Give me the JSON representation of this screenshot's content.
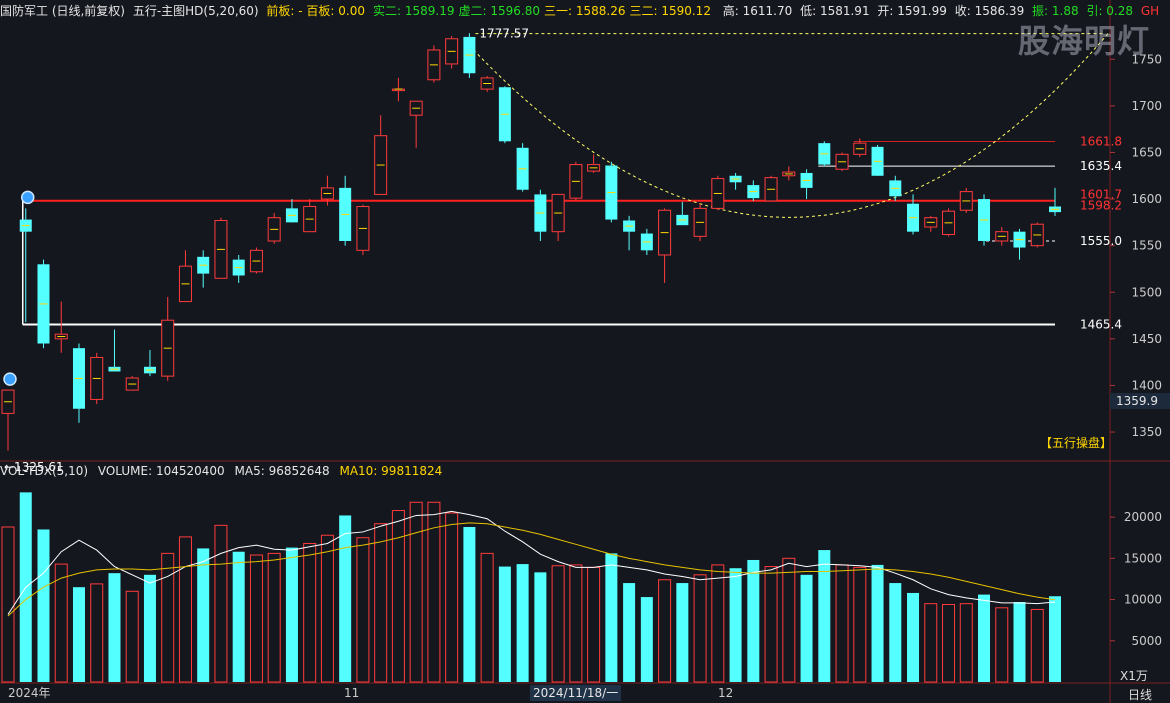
{
  "header": {
    "stock": "国防军工 (日线,前复权)",
    "indicator": "五行-主图HD(5,20,60)",
    "v1": "前板: - 百板: 0.00",
    "v2": "",
    "v3": "实二: 1589.19",
    "v4": "虚二: 1596.80",
    "v5": "三一: 1588.26",
    "v6": "三二: 1590.12",
    "high": "高: 1611.70",
    "low": "低: 1581.91",
    "open": "开: 1591.99",
    "close": "收: 1586.39",
    "amplitude": "振: 1.88",
    "ref": "引: 0.28",
    "gh": "GH"
  },
  "watermark": "股海明灯",
  "badge": "【五行操盘】",
  "current_price_tag": "1359.9",
  "volume_unit": "X1万",
  "period": "日线",
  "x_labels": [
    "2024年",
    "11",
    "2024/11/18/一",
    "12"
  ],
  "volume_header": {
    "name": "VOL-TDX(5,10)",
    "volume": "VOLUME: 104520400",
    "ma5": "MA5: 96852648",
    "ma10": "MA10: 99811824"
  },
  "chart_data": {
    "type": "candlestick",
    "price_axis": {
      "ticks": [
        1350,
        1400,
        1450,
        1500,
        1550,
        1600,
        1650,
        1700,
        1750
      ],
      "range": [
        1320,
        1790
      ]
    },
    "volume_axis": {
      "ticks": [
        5000,
        10000,
        15000,
        20000
      ],
      "range": [
        0,
        24500
      ],
      "unit": "万"
    },
    "price_labels": [
      {
        "text": "1777.57",
        "value": 1777.57
      },
      {
        "text": "←1325.61",
        "value": 1325.61
      },
      {
        "text": "1661.8",
        "value": 1661.8
      },
      {
        "text": "1635.4",
        "value": 1635.4
      },
      {
        "text": "1601.7",
        "value": 1601.7
      },
      {
        "text": "1598.2",
        "value": 1598.2
      },
      {
        "text": "1555.0",
        "value": 1555.0
      },
      {
        "text": "1465.4",
        "value": 1465.4
      }
    ],
    "levels": [
      {
        "value": 1598.2,
        "color": "#ff2020"
      },
      {
        "value": 1465.4,
        "color": "#ffffff"
      },
      {
        "value": 1635.4,
        "color": "#ffffff"
      },
      {
        "value": 1661.8,
        "color": "#d02020"
      },
      {
        "value": 1777.57,
        "color": "#ffff66"
      }
    ],
    "candles": [
      {
        "o": 1370,
        "h": 1395,
        "l": 1330,
        "c": 1395
      },
      {
        "o": 1578,
        "h": 1590,
        "l": 1468,
        "c": 1565
      },
      {
        "o": 1530,
        "h": 1535,
        "l": 1440,
        "c": 1445
      },
      {
        "o": 1450,
        "h": 1490,
        "l": 1435,
        "c": 1455
      },
      {
        "o": 1440,
        "h": 1445,
        "l": 1360,
        "c": 1375
      },
      {
        "o": 1385,
        "h": 1435,
        "l": 1380,
        "c": 1430
      },
      {
        "o": 1420,
        "h": 1460,
        "l": 1415,
        "c": 1415
      },
      {
        "o": 1395,
        "h": 1410,
        "l": 1395,
        "c": 1408
      },
      {
        "o": 1420,
        "h": 1438,
        "l": 1410,
        "c": 1413
      },
      {
        "o": 1410,
        "h": 1495,
        "l": 1405,
        "c": 1470
      },
      {
        "o": 1490,
        "h": 1545,
        "l": 1490,
        "c": 1528
      },
      {
        "o": 1538,
        "h": 1545,
        "l": 1505,
        "c": 1520
      },
      {
        "o": 1515,
        "h": 1580,
        "l": 1515,
        "c": 1577
      },
      {
        "o": 1535,
        "h": 1540,
        "l": 1510,
        "c": 1518
      },
      {
        "o": 1522,
        "h": 1548,
        "l": 1520,
        "c": 1545
      },
      {
        "o": 1555,
        "h": 1585,
        "l": 1552,
        "c": 1580
      },
      {
        "o": 1590,
        "h": 1600,
        "l": 1575,
        "c": 1575
      },
      {
        "o": 1565,
        "h": 1600,
        "l": 1565,
        "c": 1592
      },
      {
        "o": 1600,
        "h": 1625,
        "l": 1593,
        "c": 1612
      },
      {
        "o": 1612,
        "h": 1625,
        "l": 1550,
        "c": 1555
      },
      {
        "o": 1545,
        "h": 1594,
        "l": 1540,
        "c": 1592
      },
      {
        "o": 1605,
        "h": 1690,
        "l": 1605,
        "c": 1668
      },
      {
        "o": 1718,
        "h": 1730,
        "l": 1705,
        "c": 1718
      },
      {
        "o": 1690,
        "h": 1705,
        "l": 1655,
        "c": 1705
      },
      {
        "o": 1728,
        "h": 1765,
        "l": 1725,
        "c": 1760
      },
      {
        "o": 1745,
        "h": 1775,
        "l": 1740,
        "c": 1772
      },
      {
        "o": 1774,
        "h": 1778,
        "l": 1730,
        "c": 1735
      },
      {
        "o": 1718,
        "h": 1732,
        "l": 1715,
        "c": 1730
      },
      {
        "o": 1720,
        "h": 1721,
        "l": 1660,
        "c": 1662
      },
      {
        "o": 1655,
        "h": 1660,
        "l": 1608,
        "c": 1610
      },
      {
        "o": 1605,
        "h": 1610,
        "l": 1555,
        "c": 1565
      },
      {
        "o": 1565,
        "h": 1605,
        "l": 1555,
        "c": 1605
      },
      {
        "o": 1601,
        "h": 1640,
        "l": 1598,
        "c": 1637
      },
      {
        "o": 1630,
        "h": 1648,
        "l": 1628,
        "c": 1637
      },
      {
        "o": 1636,
        "h": 1640,
        "l": 1575,
        "c": 1578
      },
      {
        "o": 1577,
        "h": 1582,
        "l": 1545,
        "c": 1565
      },
      {
        "o": 1563,
        "h": 1568,
        "l": 1540,
        "c": 1545
      },
      {
        "o": 1540,
        "h": 1590,
        "l": 1510,
        "c": 1588
      },
      {
        "o": 1583,
        "h": 1597,
        "l": 1575,
        "c": 1572
      },
      {
        "o": 1560,
        "h": 1595,
        "l": 1555,
        "c": 1590
      },
      {
        "o": 1590,
        "h": 1625,
        "l": 1588,
        "c": 1622
      },
      {
        "o": 1625,
        "h": 1628,
        "l": 1610,
        "c": 1618
      },
      {
        "o": 1615,
        "h": 1620,
        "l": 1598,
        "c": 1601
      },
      {
        "o": 1598,
        "h": 1625,
        "l": 1598,
        "c": 1623
      },
      {
        "o": 1625,
        "h": 1635,
        "l": 1620,
        "c": 1629
      },
      {
        "o": 1628,
        "h": 1632,
        "l": 1600,
        "c": 1612
      },
      {
        "o": 1660,
        "h": 1662,
        "l": 1635,
        "c": 1637
      },
      {
        "o": 1632,
        "h": 1650,
        "l": 1630,
        "c": 1648
      },
      {
        "o": 1648,
        "h": 1665,
        "l": 1645,
        "c": 1660
      },
      {
        "o": 1656,
        "h": 1658,
        "l": 1625,
        "c": 1625
      },
      {
        "o": 1620,
        "h": 1625,
        "l": 1598,
        "c": 1603
      },
      {
        "o": 1595,
        "h": 1605,
        "l": 1562,
        "c": 1565
      },
      {
        "o": 1570,
        "h": 1582,
        "l": 1565,
        "c": 1580
      },
      {
        "o": 1562,
        "h": 1590,
        "l": 1560,
        "c": 1587
      },
      {
        "o": 1588,
        "h": 1612,
        "l": 1585,
        "c": 1608
      },
      {
        "o": 1600,
        "h": 1605,
        "l": 1550,
        "c": 1555
      },
      {
        "o": 1555,
        "h": 1570,
        "l": 1550,
        "c": 1565
      },
      {
        "o": 1565,
        "h": 1568,
        "l": 1535,
        "c": 1548
      },
      {
        "o": 1550,
        "h": 1575,
        "l": 1548,
        "c": 1573
      },
      {
        "o": 1592,
        "h": 1612,
        "l": 1582,
        "c": 1586
      }
    ],
    "volume": [
      18800,
      23000,
      18500,
      14300,
      11500,
      11900,
      13200,
      11000,
      13000,
      15600,
      17600,
      16200,
      19000,
      15800,
      15400,
      15600,
      16300,
      16800,
      17800,
      20200,
      17500,
      19200,
      20800,
      21800,
      21800,
      20500,
      18800,
      15600,
      14000,
      14300,
      13300,
      14100,
      14200,
      13900,
      15600,
      12000,
      10300,
      12400,
      12000,
      13000,
      14200,
      13800,
      14800,
      14000,
      15000,
      13000,
      16000,
      14200,
      13900,
      14200,
      12000,
      10800,
      9500,
      9400,
      9500,
      10600,
      9000,
      9700,
      8800,
      10400
    ],
    "ma5": [
      8200,
      11500,
      13200,
      15800,
      17200,
      16000,
      14000,
      13000,
      12000,
      12800,
      14000,
      14600,
      15600,
      16300,
      16600,
      16100,
      16000,
      16400,
      16800,
      18000,
      18200,
      18900,
      19500,
      20200,
      20300,
      20700,
      20300,
      19800,
      18300,
      17000,
      15500,
      14600,
      13900,
      13900,
      14200,
      13900,
      13600,
      13100,
      12800,
      12400,
      12600,
      12800,
      13300,
      13600,
      14400,
      14000,
      14300,
      14200,
      14100,
      13900,
      13200,
      12400,
      11300,
      10600,
      10200,
      9900,
      9600,
      9600,
      9500,
      9700
    ],
    "ma10": [
      8000,
      10000,
      11500,
      12600,
      13200,
      13600,
      13700,
      13700,
      13600,
      13800,
      14000,
      14200,
      14300,
      14500,
      14600,
      14800,
      15100,
      15400,
      15800,
      16300,
      16600,
      17000,
      17500,
      18100,
      18700,
      19100,
      19300,
      19200,
      18800,
      18400,
      17900,
      17300,
      16700,
      16100,
      15500,
      15000,
      14600,
      14200,
      13900,
      13600,
      13400,
      13300,
      13200,
      13200,
      13300,
      13400,
      13400,
      13500,
      13600,
      13700,
      13600,
      13400,
      13100,
      12700,
      12200,
      11700,
      11200,
      10700,
      10300,
      9980
    ]
  }
}
